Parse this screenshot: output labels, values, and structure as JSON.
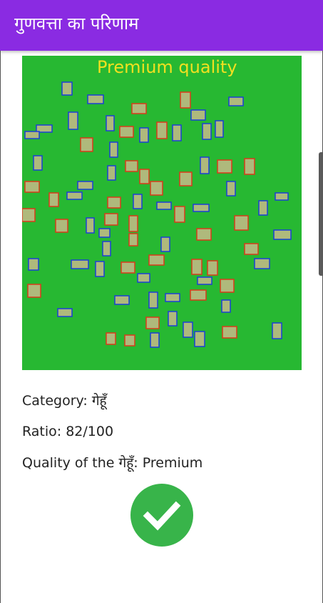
{
  "app_bar": {
    "title": "गुणवत्ता का परिणाम",
    "color": "#8a2be2"
  },
  "result_image": {
    "overlay_text": "Premium quality",
    "overlay_color": "#f0e020",
    "background_color": "#27b832",
    "box_colors": {
      "good": "#1b3fd6",
      "bad": "#d93a1a"
    }
  },
  "info": {
    "category": "Category: गेहूँ",
    "ratio": "Ratio: 82/100",
    "quality": "Quality of the गेहूँ: Premium"
  },
  "status_icon": {
    "name": "check-icon",
    "color": "#38b44a"
  }
}
